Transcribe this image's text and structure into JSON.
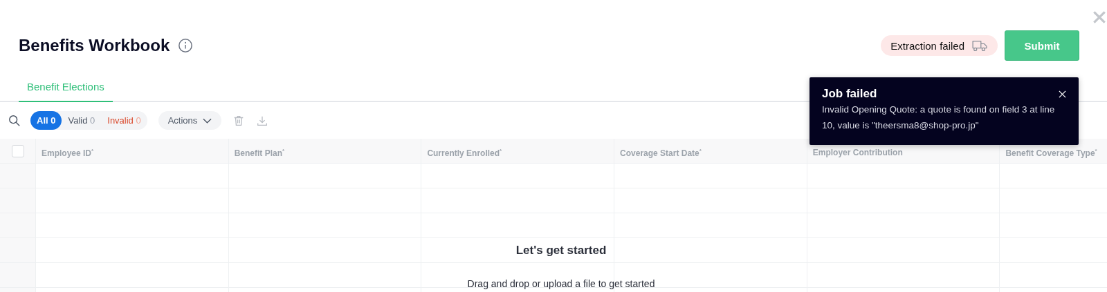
{
  "header": {
    "title": "Benefits Workbook",
    "status_badge": "Extraction failed",
    "submit_button": "Submit"
  },
  "tabs": [
    {
      "label": "Benefit Elections",
      "selected": true
    }
  ],
  "filters": [
    {
      "label": "All",
      "count": "0",
      "kind": "all",
      "selected": true
    },
    {
      "label": "Valid",
      "count": "0",
      "kind": "valid",
      "selected": false
    },
    {
      "label": "Invalid",
      "count": "0",
      "kind": "invalid",
      "selected": false
    }
  ],
  "actions_button": "Actions",
  "table": {
    "select_all_checked": false,
    "columns": [
      {
        "label": "Employee ID$^{*}$"
      },
      {
        "label": "Benefit Plan$^{*}$"
      },
      {
        "label": "Currently Enrolled$^{*}$"
      },
      {
        "label": "Coverage Start Date$^{*}$"
      },
      {
        "label": "Employer Contribution"
      },
      {
        "label": "Benefit Coverage Type$^{*}$"
      }
    ]
  },
  "empty_state": {
    "title": "Let's get started",
    "message": "Drag and drop or upload a file to get started"
  },
  "toast": {
    "title": "Job failed",
    "message": "Invalid Opening Quote: a quote is found on field 3 at line 10, value is \"theersma8@shop-pro.jp\""
  }
}
